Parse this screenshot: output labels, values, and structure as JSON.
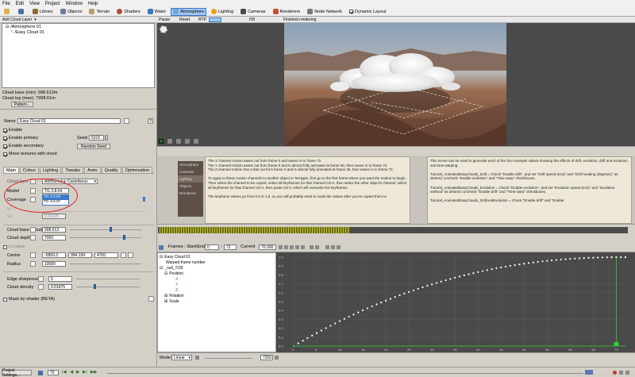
{
  "menu": [
    "File",
    "Edit",
    "View",
    "Project",
    "Window",
    "Help"
  ],
  "toolbar": {
    "items": [
      {
        "label": "Library",
        "color": "#8a6d3b"
      },
      {
        "label": "Objects",
        "color": "#6a7d9a"
      },
      {
        "label": "Terrain",
        "color": "#b8a070"
      },
      {
        "label": "Shaders",
        "color": "#b04a3a"
      },
      {
        "label": "Water",
        "color": "#3a78b8"
      },
      {
        "label": "Atmosphere",
        "color": "#70a8d8"
      },
      {
        "label": "Lighting",
        "color": "#e8a020"
      },
      {
        "label": "Cameras",
        "color": "#4a4a4a"
      },
      {
        "label": "Renderers",
        "color": "#c05030"
      },
      {
        "label": "Node Network",
        "color": "#7a7a7a"
      }
    ],
    "dynamic_layout": "Dynamic Layout"
  },
  "subbar": {
    "add_cloud_layer": "Add Cloud Layer",
    "pause": "Pause",
    "reset": "Reset",
    "rtp": "RTP",
    "hd": "HD",
    "status": "Finished rendering"
  },
  "tree": {
    "items": [
      "/Atmosphere 01",
      "/Easy Cloud 01"
    ]
  },
  "info": {
    "cloud_base": "Cloud base (min): 998.613m",
    "cloud_top": "Cloud top (max): 7998.61m",
    "pattern_button": "Pattern..."
  },
  "props": {
    "name_label": "Name",
    "name_value": "Easy Cloud 01",
    "help": "?",
    "enable": "Enable",
    "enable_primary": "Enable primary",
    "seed_label": "Seed",
    "seed_value": "5315",
    "enable_secondary": "Enable secondary",
    "random_seed": "Random Seed",
    "move_textures": "Move textures with cloud"
  },
  "tabs": [
    "Main",
    "Colour",
    "Lighting",
    "Tweaks",
    "Anim",
    "Quality",
    "Optimisation"
  ],
  "main": {
    "cloud_type_label": "Cloud type",
    "cloud_type_value": "Altocumulus Castellanus",
    "model_label": "Model",
    "model_value": "TG 3.8.04",
    "dropdown_options": [
      "TG 3.8.04",
      "TG 3.8.07"
    ],
    "coverage_label": "Coverage",
    "coverage_hidden_value": "0.50125",
    "cloud_base_altitude_label": "Cloud base altitude",
    "cloud_base_altitude_value": "998.613",
    "cloud_depth_label": "Cloud depth",
    "cloud_depth_value": "7000",
    "localise_label": "Localise",
    "centre_label": "Centre",
    "centre_x": "-5850.3",
    "centre_y": "994.199",
    "centre_z": "4700",
    "radius_label": "Radius",
    "radius_value": "10000",
    "edge_sharpness_label": "Edge sharpness",
    "edge_sharpness_value": "5",
    "cloud_density_label": "Cloud density",
    "cloud_density_value": "0.01875",
    "mask_label": "Mask by shader (BETA)"
  },
  "side_list": [
    "Atmosphere",
    "Cameras",
    "Lighting",
    "Objects",
    "Renderers"
  ],
  "text_col1": "The X channel motion eases out from frame 0 and eases in to frame 72.\nThe Y channel motion eases out from frame 0 and is almost fully animated at frame 60, then eases in to frame 72.\nThe Z channel motion has a fast out from frame 0 and is almost fully animated at frame 36, then eases in to frame 72.\n\nTo apply to these motion channels to another object in Terragen, first go to the first frame where you want the motion to begin. Then select the channel to be copied, select all keyframes for that channel C8-A, then select the other object's channel, select all keyframes for that channel C8-A, then paste C8-V, which will overwrite the keyframes.\n\nThe keyframe values go from 0.0 to 1.0, so you will probably need to scale the values after you've copied them to",
  "text_col2": "This scene can be used to generate each of the four example videos showing the effects of drift, evolution, drift and evolution, and time warping.\n\nTutorial_AnimatedEasyClouds_Drift = Check \"Enable drift\", and set \"Drift speed (m/s)\" and \"Drift heading (degrees)\" as desired. Uncheck \"Enable evolution\" and \"Time warp\" checkboxes.\n\nTutorial_AnimatedEasyClouds_Evolution = Check \"Enable evolution\", and set \"Evolution speed (m/s)\" and \"Evolution method\" as desired. Uncheck \"Enable drift\" and \"Time warp\" checkboxes.\n\nTutorial_AnimatedEasyClouds_DriftAndEvolution = Check \"Enable drift\" and \"Enable",
  "anim": {
    "frames_label": "Frames : Start/End",
    "start": "0",
    "end": "72",
    "current_label": "Current",
    "current": "70.000"
  },
  "tracks": {
    "root": "Easy Cloud 01",
    "warped": "Warped frame number",
    "null": "_null_TCB",
    "position": "Position",
    "x": "X",
    "y": "Y",
    "z": "Z",
    "rotation": "Rotation",
    "scale": "Scale"
  },
  "graph": {
    "y_ticks": [
      "1.0",
      "0.9",
      "0.8",
      "0.7",
      "0.6",
      "0.5",
      "0.4",
      "0.3",
      "0.2",
      "0.1",
      "0.0"
    ],
    "x_ticks": [
      "0",
      "5",
      "10",
      "15",
      "20",
      "25",
      "30",
      "35",
      "40",
      "45",
      "50",
      "55",
      "60",
      "65",
      "70"
    ],
    "current_frame": 70,
    "end_frame": 72
  },
  "bottom": {
    "project_settings": "Project Settings...",
    "frame": "70",
    "mode_label": "Mode:",
    "mode_value": "Linear",
    "end_value": "7200"
  }
}
